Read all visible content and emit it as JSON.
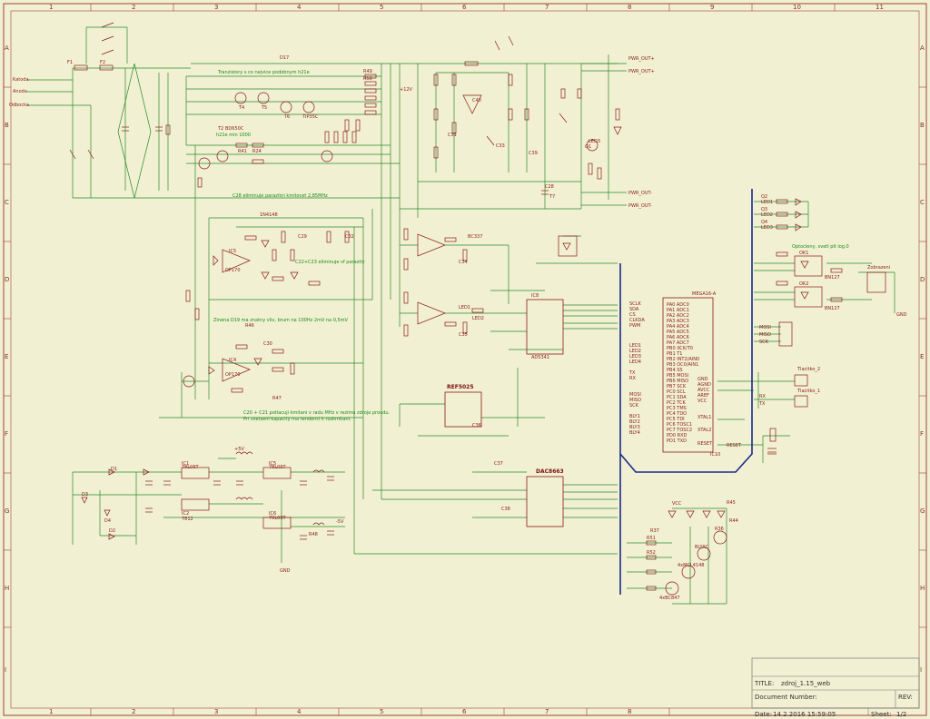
{
  "frame": {
    "cols": [
      "1",
      "2",
      "3",
      "4",
      "5",
      "6",
      "7",
      "8",
      "9",
      "10",
      "11"
    ],
    "rows": [
      "A",
      "B",
      "C",
      "D",
      "E",
      "F",
      "G",
      "H",
      "I"
    ]
  },
  "inputs": [
    "Katoda",
    "Anoda",
    "Odbocka"
  ],
  "notes": [
    "Tranzistory s co nejvice podobnym h21e",
    "h21e min 1000",
    "C28 eliminuje parazitni kmitocet 2,85MHz",
    "C22+C23 eliminuje vf parazity",
    "Zinena D19 ma znatny vliv, brum na 100Hz 2mV na 0,5mV",
    "C20 + C21 potlacuji kmitani v radu MHz v rezimu zdroje proudu.",
    "Pri zvetseni kapacity ma tendenci k rozkmitani.",
    "Optocleny, svetl plt log.0"
  ],
  "chips": {
    "ic8": {
      "name": "IC8",
      "part": "AD5341"
    },
    "ref": {
      "name": "REF5025",
      "part": "REF5025"
    },
    "ic9": {
      "name": "DAC8663",
      "part": "DAC8663"
    },
    "ic10": {
      "name": "MEGA16-A",
      "part": "IC10"
    },
    "ic1": {
      "name": "IC1",
      "part": "78L05T"
    },
    "ic2": {
      "name": "IC2",
      "part": "7812"
    },
    "ic5": {
      "name": "IC5",
      "part": "78L05T"
    },
    "ic6": {
      "name": "IC6",
      "part": "79L05T"
    },
    "ok1": {
      "name": "OK1",
      "part": "BN127"
    },
    "ok2": {
      "name": "OK2",
      "part": "BN127"
    },
    "ic5op": {
      "name": "IC5",
      "part": "OP170"
    },
    "ic4op": {
      "name": "IC4",
      "part": "OP170"
    }
  },
  "mcu_left_pins": [
    "PA0 ADC0",
    "PA1 ADC1",
    "PA2 ADC2",
    "PA3 ADC3",
    "PA4 ADC4",
    "PA5 ADC5",
    "PA6 ADC6",
    "PA7 ADC7",
    "PB0 XCK/T0",
    "PB1 T1",
    "PB2 INT2/AIN0",
    "PB3 OC0/AIN1",
    "PB4 SS",
    "PB5 MOSI",
    "PB6 MISO",
    "PB7 SCK",
    "PC0 SCL",
    "PC1 SDA",
    "PC2 TCK",
    "PC3 TMS",
    "PC4 TDO",
    "PC5 TDI",
    "PC6 TOSC1",
    "PC7 TOSC2",
    "PD0 RXD",
    "PD1 TXD"
  ],
  "mcu_right_pins": [
    "GND",
    "AGND",
    "AVCC",
    "AREF",
    "VCC",
    "XTAL1",
    "XTAL2",
    "RESET"
  ],
  "bus_labels_left": [
    "SCLK",
    "SDA",
    "CS",
    "CLKDA",
    "PWM",
    "LED1",
    "LED2",
    "LED3",
    "LED4",
    "TX",
    "RX",
    "MOSI",
    "MISO",
    "SCK",
    "BLY1",
    "BLY2",
    "BLY3",
    "BLY4"
  ],
  "bus_labels_right": [
    "LED1",
    "LED2",
    "LED3",
    "MOSI",
    "MISO",
    "SCK",
    "RESET",
    "RX",
    "TX"
  ],
  "net_labels": [
    "PWR_OUT+",
    "PWR_OUT+",
    "PWR_OUT-",
    "PWR_OUT-",
    "GND",
    "+5V",
    "-5V",
    "+12V",
    "VCC"
  ],
  "connectors": [
    "Tlacitko_2",
    "Tlacitko_1",
    "Zobrazeni",
    "OK1",
    "OK2",
    "GND"
  ],
  "title_block": {
    "title_label": "TITLE:",
    "title_value": "zdroj_1.15_web",
    "doc_label": "Document Number:",
    "rev_label": "REV:",
    "date_label": "Date:",
    "date_value": "14.2.2016 15:59:05",
    "sheet_label": "Sheet:",
    "sheet_value": "1/2"
  },
  "colors": {
    "background": "#f1f0d2",
    "wire": "#2a8a2a",
    "part": "#8a1a1a",
    "bus": "#1a2a8a",
    "frame": "#a04040"
  },
  "parts_misc": [
    "F1",
    "F2",
    "T2",
    "BD650C",
    "T4",
    "T5",
    "T6",
    "TIP35C",
    "D1",
    "D2",
    "D3",
    "D4",
    "D17",
    "1N4148",
    "R41",
    "R24",
    "C28",
    "C29",
    "C30",
    "C31",
    "C32",
    "C33",
    "C34",
    "C35",
    "C36",
    "C37",
    "C38",
    "C39",
    "C40",
    "R46",
    "R47",
    "R48",
    "T7",
    "BC337",
    "LED1",
    "LED2",
    "LED3",
    "Q1",
    "Q2",
    "Q3",
    "Q4",
    "4xBC847",
    "4xMCL4148",
    "BLYAC",
    "R36",
    "R37",
    "R44",
    "R45",
    "R49",
    "R50",
    "R51",
    "R52"
  ]
}
